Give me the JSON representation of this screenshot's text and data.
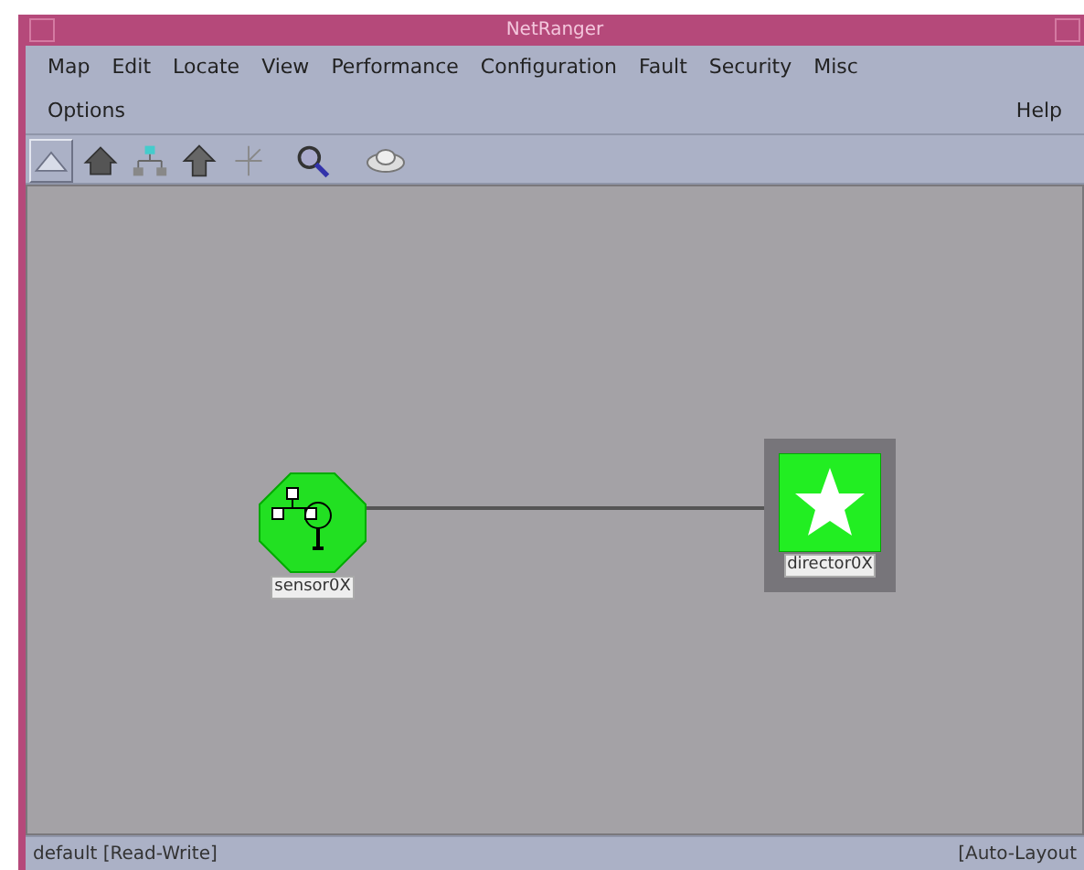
{
  "window": {
    "title": "NetRanger"
  },
  "menu_row_1": [
    "Map",
    "Edit",
    "Locate",
    "View",
    "Performance",
    "Configuration",
    "Fault",
    "Security",
    "Misc"
  ],
  "menu_row_2": {
    "left": [
      "Options"
    ],
    "right": [
      "Help"
    ]
  },
  "toolbar": [
    {
      "kind": "triangle",
      "selected": true
    },
    {
      "kind": "house",
      "selected": false
    },
    {
      "kind": "tree",
      "selected": false
    },
    {
      "kind": "up",
      "selected": false
    },
    {
      "kind": "branch",
      "selected": false
    },
    {
      "kind": "zoom",
      "selected": false
    },
    {
      "kind": "cloud",
      "selected": false
    }
  ],
  "map": {
    "nodes": [
      {
        "kind": "sensor",
        "label": "sensor0X",
        "selected": false
      },
      {
        "kind": "director",
        "label": "director0X",
        "selected": true
      }
    ]
  },
  "status_bar": {
    "left": "default [Read-Write]",
    "right": "[Auto-Layout"
  }
}
